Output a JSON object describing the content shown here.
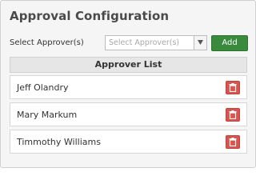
{
  "title": "Approval Configuration",
  "approver_select": {
    "label": "Select Approver(s)",
    "placeholder": "Select Approver(s)",
    "add_label": "Add"
  },
  "approver_list": {
    "header": "Approver List",
    "items": [
      {
        "name": "Jeff Olandry",
        "action_icon": "trash-icon"
      },
      {
        "name": "Mary Markum",
        "action_icon": "trash-icon"
      },
      {
        "name": "Timmothy Williams",
        "action_icon": "trash-icon"
      }
    ]
  },
  "colors": {
    "add_button": "#3a8a3e",
    "delete_button": "#d9534f",
    "panel_bg": "#f5f5f5",
    "header_bg": "#e6e6e6"
  }
}
